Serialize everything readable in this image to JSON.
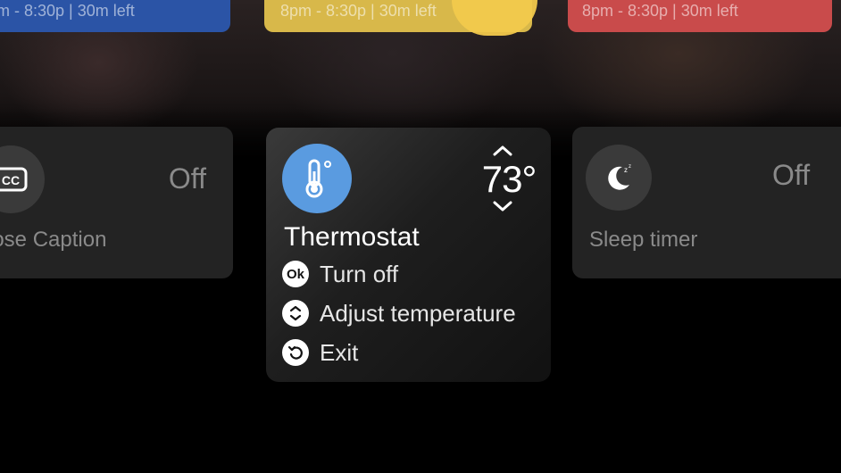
{
  "programs": [
    {
      "time": "m - 8:30p | 30m left",
      "color": "#2b54a6"
    },
    {
      "time": "8pm - 8:30p | 30m left",
      "color": "#d8b84a"
    },
    {
      "time": "8pm - 8:30p | 30m left",
      "color": "#c94b4b"
    }
  ],
  "close_caption": {
    "label": "lose Caption",
    "status": "Off",
    "icon": "cc-icon",
    "icon_text": "CC"
  },
  "thermostat": {
    "title": "Thermostat",
    "temperature": "73°",
    "icon": "thermometer-icon",
    "accent": "#5a9be0",
    "actions": [
      {
        "key_label": "Ok",
        "label": "Turn off",
        "icon": "ok-button-icon"
      },
      {
        "key_label": "",
        "label": "Adjust temperature",
        "icon": "up-down-icon"
      },
      {
        "key_label": "",
        "label": "Exit",
        "icon": "back-icon"
      }
    ]
  },
  "sleep_timer": {
    "label": "Sleep timer",
    "status": "Off",
    "icon": "moon-icon"
  }
}
